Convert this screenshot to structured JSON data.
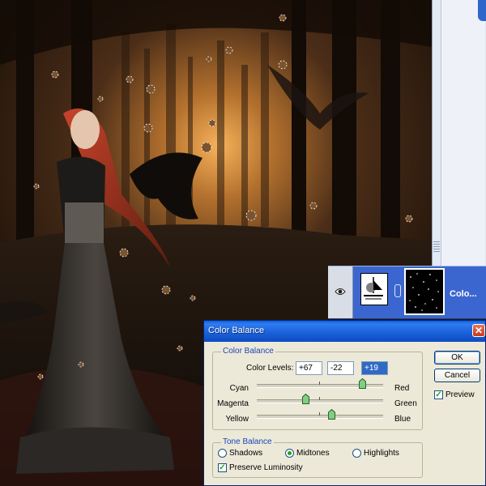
{
  "layers": {
    "layer_name": "Colo..."
  },
  "dialog": {
    "title": "Color Balance",
    "close_glyph": "✕",
    "color_balance_group": {
      "legend": "Color Balance",
      "levels_label": "Color Levels:",
      "levels": [
        "+67",
        "-22",
        "+19"
      ],
      "selected_level_index": 2,
      "sliders": [
        {
          "left": "Cyan",
          "right": "Red",
          "value": 67
        },
        {
          "left": "Magenta",
          "right": "Green",
          "value": -22
        },
        {
          "left": "Yellow",
          "right": "Blue",
          "value": 19
        }
      ],
      "slider_range": [
        -100,
        100
      ]
    },
    "tone_balance_group": {
      "legend": "Tone Balance",
      "options": [
        "Shadows",
        "Midtones",
        "Highlights"
      ],
      "selected": "Midtones",
      "preserve_luminosity_label": "Preserve Luminosity",
      "preserve_luminosity_checked": true
    },
    "ok_label": "OK",
    "cancel_label": "Cancel",
    "preview_label": "Preview",
    "preview_checked": true
  },
  "colors": {
    "titlebar": "#0a5fe0",
    "dialog_bg": "#ece9d8",
    "group_legend": "#1c46b8",
    "layer_row": "#3c66cf",
    "thumb_fill": "#7ed07e",
    "check_green": "#21a121"
  },
  "icons": {
    "eye": "eye-icon",
    "link": "link-icon",
    "adjustment": "color-balance-adjustment-icon",
    "close": "close-icon"
  }
}
